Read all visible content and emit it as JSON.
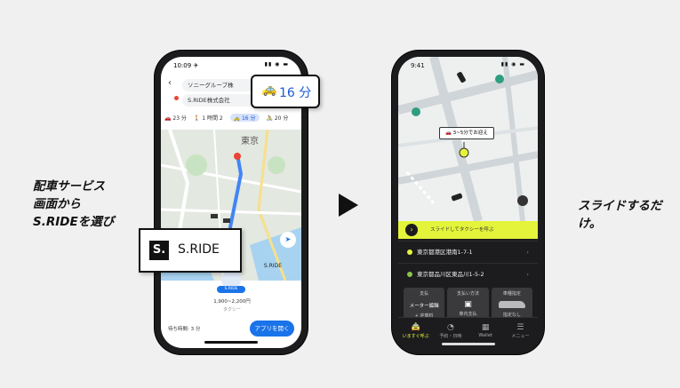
{
  "captions": {
    "left": [
      "配車サービス",
      "画面から",
      "S.RIDEを選び"
    ],
    "right": "スライドするだけ。"
  },
  "left_phone": {
    "status_time": "10:09 ✈",
    "status_icons": "▮▮ ◉ ▬",
    "origin": "ソニーグループ株",
    "destination": "S.RIDE株式会社",
    "modes": [
      "🚗 23 分",
      "🚶 1 時間 2",
      "🚕 16 分",
      "🚴 20 分"
    ],
    "map_label": "東京",
    "time_callout": "16 分",
    "sride_callout": "S.RIDE",
    "sride_small_label": "S.RIDE",
    "fare_badge": "S.RIDE",
    "fare": "1,900~2,200円",
    "fare_type": "タクシー",
    "wait": "待ち時間: 3 分",
    "open_app": "アプリを開く"
  },
  "right_phone": {
    "status_time": "9:41",
    "status_icons": "▮▮ ◉ ▬",
    "eta_label": "3~5分でお迎え",
    "slide_label": "スライドしてタクシーを呼ぶ",
    "pickup": "東京都港区港南1-7-1",
    "dropoff": "東京都品川区東品川1-5-2",
    "options": [
      {
        "title": "支払",
        "value": "メーター編輯",
        "sub": "+ 迎車料"
      },
      {
        "title": "支払い方法",
        "value": "",
        "sub": "車内支払"
      },
      {
        "title": "車種指定",
        "value": "",
        "sub": "指定なし"
      }
    ],
    "tabs": [
      "いますぐ呼ぶ",
      "予約・日時",
      "Wallet",
      "メニュー"
    ]
  },
  "colors": {
    "accent_yellow": "#e4f43a",
    "google_blue": "#1a73e8",
    "route_blue": "#4285f4",
    "pin_red": "#ea4335"
  }
}
